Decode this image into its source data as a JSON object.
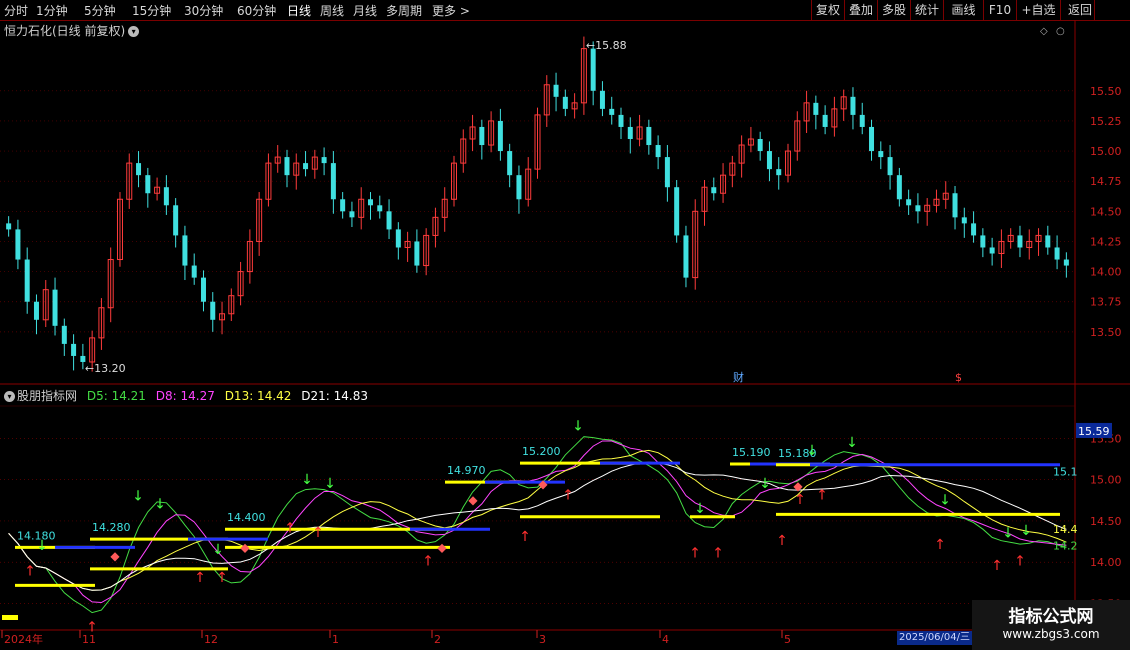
{
  "toolbar": {
    "periods": [
      "分时",
      "1分钟",
      "5分钟",
      "15分钟",
      "30分钟",
      "60分钟",
      "日线",
      "周线",
      "月线",
      "多周期",
      "更多"
    ],
    "more_arrow": ">",
    "active": "日线",
    "right_buttons": [
      "复权",
      "叠加",
      "多股",
      "统计",
      "画线",
      "F10",
      "+自选",
      "返回"
    ]
  },
  "main_chart": {
    "title": "恒力石化(日线 前复权)",
    "y_ticks": [
      "15.50",
      "15.25",
      "15.00",
      "14.75",
      "14.50",
      "14.25",
      "14.00",
      "13.75",
      "13.50"
    ],
    "high_label": "15.88",
    "low_label": "13.20",
    "markers": [
      "财",
      "$"
    ]
  },
  "indicator": {
    "name": "股朋指标网",
    "values": [
      {
        "label": "D5: 14.21",
        "color": "#44dd44"
      },
      {
        "label": "D8: 14.27",
        "color": "#ff44ff"
      },
      {
        "label": "D13: 14.42",
        "color": "#ffff44"
      },
      {
        "label": "D21: 14.83",
        "color": "#ffffff"
      }
    ],
    "y_ticks": [
      "15.50",
      "15.00",
      "14.50",
      "14.00",
      "13.50"
    ],
    "y_highlight": "15.59",
    "level_labels": [
      "14.180",
      "14.280",
      "14.400",
      "14.970",
      "15.200",
      "15.190",
      "15.180"
    ],
    "right_labels": [
      "15.1",
      "14.4",
      "14.2"
    ]
  },
  "x_axis": {
    "labels": [
      "2024年",
      "11",
      "12",
      "1",
      "2",
      "3",
      "4",
      "5"
    ],
    "date_box": "2025/06/04/三"
  },
  "watermark": {
    "line1": "指标公式网",
    "line2": "www.zbgs3.com"
  },
  "chart_data": {
    "type": "candlestick",
    "title": "恒力石化(日线 前复权)",
    "ylim": [
      13.2,
      15.88
    ],
    "y_axis_ticks": [
      13.5,
      13.75,
      14.0,
      14.25,
      14.5,
      14.75,
      15.0,
      15.25,
      15.5
    ],
    "x_labels": [
      "2024年",
      "11",
      "12",
      "1",
      "2",
      "3",
      "4",
      "5"
    ],
    "closes": [
      14.35,
      14.1,
      13.75,
      13.6,
      13.85,
      13.55,
      13.4,
      13.3,
      13.25,
      13.45,
      13.7,
      14.1,
      14.6,
      14.9,
      14.8,
      14.65,
      14.7,
      14.55,
      14.3,
      14.05,
      13.95,
      13.75,
      13.6,
      13.65,
      13.8,
      14.0,
      14.25,
      14.6,
      14.9,
      14.95,
      14.8,
      14.9,
      14.85,
      14.95,
      14.9,
      14.6,
      14.5,
      14.45,
      14.6,
      14.55,
      14.5,
      14.35,
      14.2,
      14.25,
      14.05,
      14.3,
      14.45,
      14.6,
      14.9,
      15.1,
      15.2,
      15.05,
      15.25,
      15.0,
      14.8,
      14.6,
      14.85,
      15.3,
      15.55,
      15.45,
      15.35,
      15.4,
      15.85,
      15.5,
      15.35,
      15.3,
      15.2,
      15.1,
      15.2,
      15.05,
      14.95,
      14.7,
      14.3,
      13.95,
      14.5,
      14.7,
      14.65,
      14.8,
      14.9,
      15.05,
      15.1,
      15.0,
      14.85,
      14.8,
      15.0,
      15.25,
      15.4,
      15.3,
      15.2,
      15.35,
      15.45,
      15.3,
      15.2,
      15.0,
      14.95,
      14.8,
      14.6,
      14.55,
      14.5,
      14.55,
      14.6,
      14.65,
      14.45,
      14.4,
      14.3,
      14.2,
      14.15,
      14.25,
      14.3,
      14.2,
      14.25,
      14.3,
      14.2,
      14.1,
      14.05
    ],
    "indicator": {
      "name": "股朋指标网",
      "D5": 14.21,
      "D8": 14.27,
      "D13": 14.42,
      "D21": 14.83,
      "ylim": [
        13.3,
        15.65
      ],
      "y_axis_ticks": [
        13.5,
        14.0,
        14.5,
        15.0,
        15.5
      ],
      "levels": [
        {
          "label": "14.180",
          "value": 14.18
        },
        {
          "label": "14.280",
          "value": 14.28
        },
        {
          "label": "14.400",
          "value": 14.4
        },
        {
          "label": "14.970",
          "value": 14.97
        },
        {
          "label": "15.200",
          "value": 15.2
        },
        {
          "label": "15.190",
          "value": 15.19
        },
        {
          "label": "15.180",
          "value": 15.18
        }
      ]
    }
  }
}
